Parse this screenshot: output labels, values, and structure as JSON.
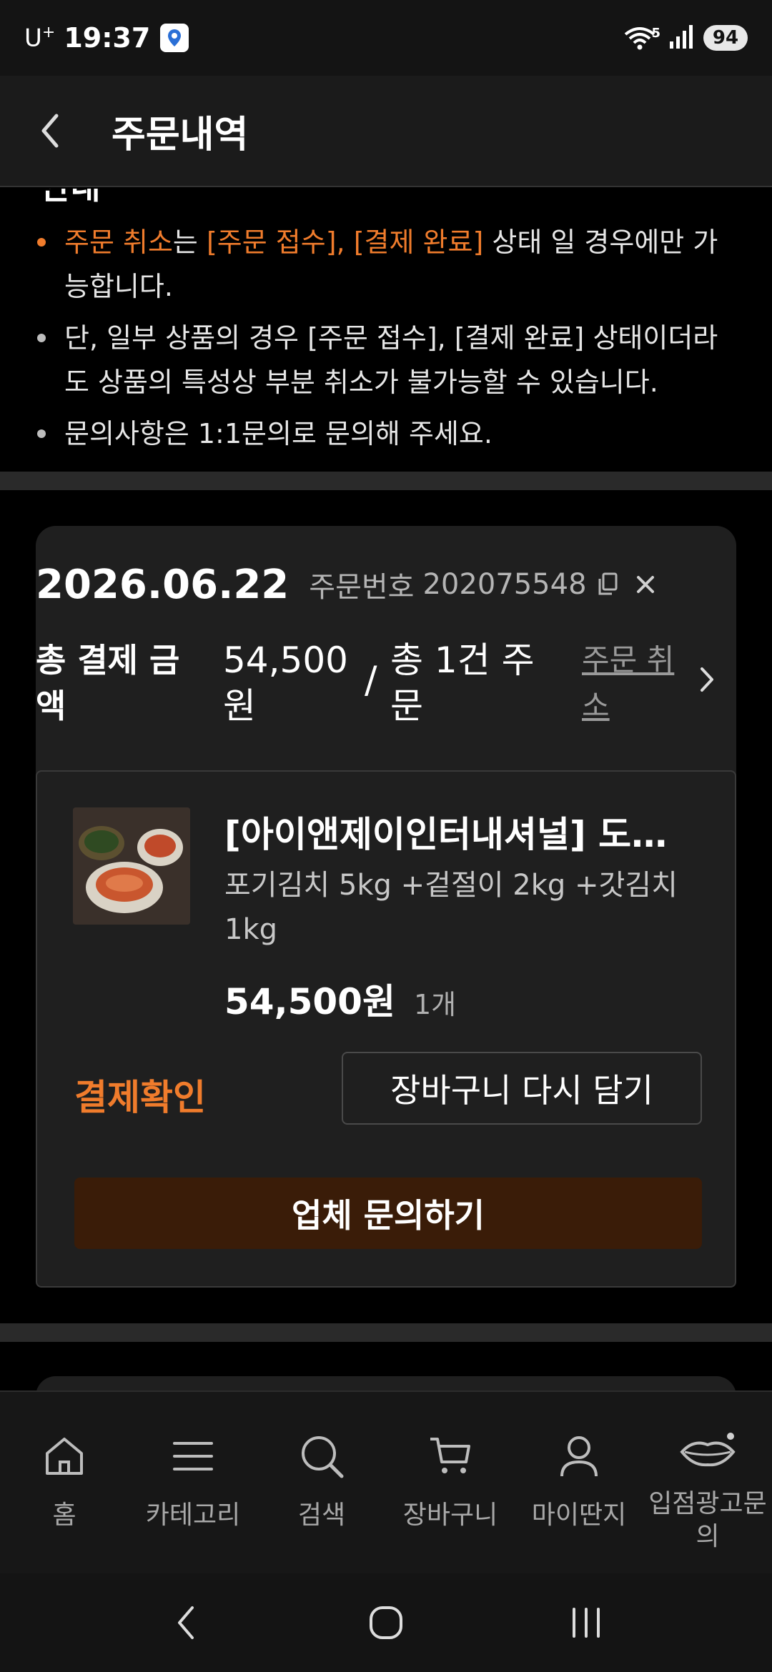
{
  "status_bar": {
    "carrier": "U",
    "carrier_sup": "+",
    "time": "19:37",
    "wifi_label": "5",
    "battery": "94"
  },
  "header": {
    "title": "주문내역"
  },
  "notice": {
    "partial_heading": "안내",
    "items": [
      {
        "lead": "주문 취소",
        "mid": "는 ",
        "highlight": "[주문 접수], [결제 완료]",
        "rest": " 상태 일 경우에만 가능합니다."
      },
      {
        "text": "단, 일부 상품의 경우 [주문 접수], [결제 완료] 상태이더라도 상품의 특성상 부분 취소가 불가능할 수 있습니다."
      },
      {
        "text": "문의사항은 1:1문의로 문의해 주세요."
      }
    ]
  },
  "order": {
    "date": "2026.06.22",
    "order_no_label": "주문번호",
    "order_no": "202075548",
    "total_label": "총 결제 금액",
    "total_amount": "54,500원",
    "separator": "/",
    "total_count": "총 1건 주문",
    "cancel_label": "주문 취소",
    "product": {
      "name": "[아이앤제이인터내셔널] 도…",
      "option": "포기김치 5kg +겉절이 2kg +갓김치 1kg",
      "price": "54,500원",
      "qty": "1개",
      "status": "결제확인",
      "recart_label": "장바구니 다시 담기",
      "inquiry_label": "업체 문의하기"
    }
  },
  "bottom_nav": {
    "items": [
      {
        "label": "홈",
        "icon": "home-icon"
      },
      {
        "label": "카테고리",
        "icon": "menu-icon"
      },
      {
        "label": "검색",
        "icon": "search-icon"
      },
      {
        "label": "장바구니",
        "icon": "cart-icon"
      },
      {
        "label": "마이딴지",
        "icon": "user-icon"
      },
      {
        "label": "입점광고문의",
        "icon": "lips-icon"
      }
    ]
  },
  "colors": {
    "accent_orange": "#f07c2c",
    "inquiry_button": "#3a1c08",
    "card_bg": "#1f1f1f"
  }
}
